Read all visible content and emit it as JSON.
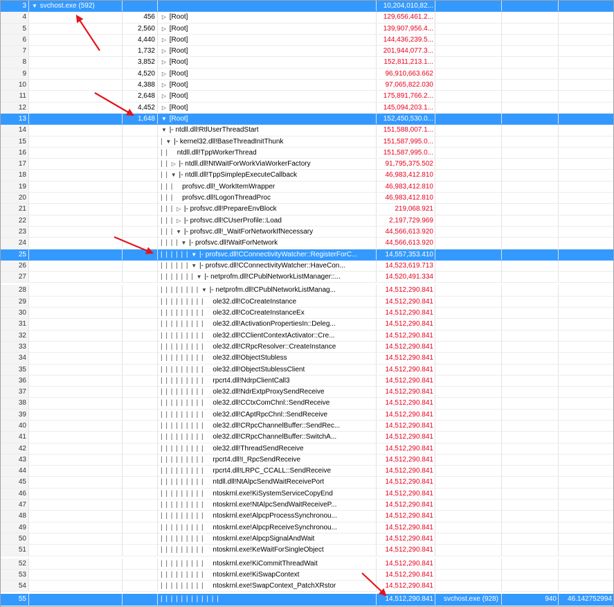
{
  "colors": {
    "selection": "#3399ff",
    "weight_text": "#e8001c",
    "arrow": "#e3141f"
  },
  "icons": {
    "expanded": "triangle-down-icon",
    "collapsed": "triangle-right-icon"
  },
  "rows": [
    {
      "line": "3",
      "process": "svchost.exe (592)",
      "thread": "",
      "stack": "svchost.exe (592)",
      "indent": 0,
      "guide": "",
      "toggle": "expanded",
      "weight": "10,204,010,82...",
      "sel": true,
      "gap": false
    },
    {
      "line": "4",
      "process": "",
      "thread": "456",
      "stack": "[Root]",
      "indent": 0,
      "guide": "",
      "toggle": "collapsed",
      "weight": "129,656,461.2..."
    },
    {
      "line": "5",
      "process": "",
      "thread": "2,560",
      "stack": "[Root]",
      "indent": 0,
      "guide": "",
      "toggle": "collapsed",
      "weight": "139,907,956.4..."
    },
    {
      "line": "6",
      "process": "",
      "thread": "4,440",
      "stack": "[Root]",
      "indent": 0,
      "guide": "",
      "toggle": "collapsed",
      "weight": "144,436,239.5..."
    },
    {
      "line": "7",
      "process": "",
      "thread": "1,732",
      "stack": "[Root]",
      "indent": 0,
      "guide": "",
      "toggle": "collapsed",
      "weight": "201,944,077.3..."
    },
    {
      "line": "8",
      "process": "",
      "thread": "3,852",
      "stack": "[Root]",
      "indent": 0,
      "guide": "",
      "toggle": "collapsed",
      "weight": "152,811,213.1..."
    },
    {
      "line": "9",
      "process": "",
      "thread": "4,520",
      "stack": "[Root]",
      "indent": 0,
      "guide": "",
      "toggle": "collapsed",
      "weight": "96,910,663.662"
    },
    {
      "line": "10",
      "process": "",
      "thread": "4,388",
      "stack": "[Root]",
      "indent": 0,
      "guide": "",
      "toggle": "collapsed",
      "weight": "97,065,822.030"
    },
    {
      "line": "11",
      "process": "",
      "thread": "2,648",
      "stack": "[Root]",
      "indent": 0,
      "guide": "",
      "toggle": "collapsed",
      "weight": "175,891,766.2..."
    },
    {
      "line": "12",
      "process": "",
      "thread": "4,452",
      "stack": "[Root]",
      "indent": 0,
      "guide": "",
      "toggle": "collapsed",
      "weight": "145,094,203.1..."
    },
    {
      "line": "13",
      "process": "",
      "thread": "1,648",
      "stack": "[Root]",
      "indent": 0,
      "guide": "",
      "toggle": "expanded",
      "weight": "152,450,530.0...",
      "sel": true
    },
    {
      "line": "14",
      "process": "",
      "thread": "",
      "stack": "|- ntdll.dll!RtlUserThreadStart",
      "indent": 0,
      "guide": "",
      "toggle": "expanded",
      "weight": "151,588,007.1..."
    },
    {
      "line": "15",
      "process": "",
      "thread": "",
      "stack": "|- kernel32.dll!BaseThreadInitThunk",
      "indent": 1,
      "guide": "|",
      "toggle": "expanded",
      "weight": "151,587,995.0..."
    },
    {
      "line": "16",
      "process": "",
      "thread": "",
      "stack": "ntdll.dll!TppWorkerThread",
      "indent": 1,
      "guide": "| |",
      "toggle": "",
      "weight": "151,587,995.0..."
    },
    {
      "line": "17",
      "process": "",
      "thread": "",
      "stack": "|- ntdll.dll!NtWaitForWorkViaWorkerFactory",
      "indent": 1,
      "guide": "| |",
      "toggle": "collapsed",
      "weight": "91,795,375.502"
    },
    {
      "line": "18",
      "process": "",
      "thread": "",
      "stack": "|- ntdll.dll!TppSimplepExecuteCallback",
      "indent": 1,
      "guide": "| |",
      "toggle": "expanded",
      "weight": "46,983,412.810"
    },
    {
      "line": "19",
      "process": "",
      "thread": "",
      "stack": "profsvc.dll!_WorkItemWrapper",
      "indent": 1,
      "guide": "| | |",
      "toggle": "",
      "weight": "46,983,412.810"
    },
    {
      "line": "20",
      "process": "",
      "thread": "",
      "stack": "profsvc.dll!LogonThreadProc",
      "indent": 1,
      "guide": "| | |",
      "toggle": "",
      "weight": "46,983,412.810"
    },
    {
      "line": "21",
      "process": "",
      "thread": "",
      "stack": "|- profsvc.dll!PrepareEnvBlock",
      "indent": 1,
      "guide": "| | |",
      "toggle": "collapsed",
      "weight": "219,068.921"
    },
    {
      "line": "22",
      "process": "",
      "thread": "",
      "stack": "|- profsvc.dll!CUserProfile::Load",
      "indent": 1,
      "guide": "| | |",
      "toggle": "collapsed",
      "weight": "2,197,729.969"
    },
    {
      "line": "23",
      "process": "",
      "thread": "",
      "stack": "|- profsvc.dll!_WaitForNetworkIfNecessary",
      "indent": 1,
      "guide": "| | |",
      "toggle": "expanded",
      "weight": "44,566,613.920"
    },
    {
      "line": "24",
      "process": "",
      "thread": "",
      "stack": "|- profsvc.dll!WaitForNetwork",
      "indent": 1,
      "guide": "| | | |",
      "toggle": "expanded",
      "weight": "44,566,613.920"
    },
    {
      "line": "25",
      "process": "",
      "thread": "",
      "stack": "|- profsvc.dll!CConnectivityWatcher::RegisterForC...",
      "indent": 1,
      "guide": "| | | | | |",
      "toggle": "expanded",
      "weight": "14,557,353.410",
      "sel": true
    },
    {
      "line": "26",
      "process": "",
      "thread": "",
      "stack": "|- profsvc.dll!CConnectivityWatcher::HaveCon...",
      "indent": 1,
      "guide": "| | | | | |",
      "toggle": "expanded",
      "weight": "14,523,619.713"
    },
    {
      "line": "27",
      "process": "",
      "thread": "",
      "stack": "|- netprofm.dll!CPublNetworkListManager::...",
      "indent": 1,
      "guide": "| | | | | | |",
      "toggle": "expanded",
      "weight": "14,520,491.334"
    },
    {
      "line": "28",
      "process": "",
      "thread": "",
      "stack": "|- netprofm.dll!CPublNetworkListManag...",
      "indent": 1,
      "guide": "| | | | | | | |",
      "toggle": "expanded",
      "weight": "14,512,290.841",
      "gap": true
    },
    {
      "line": "29",
      "process": "",
      "thread": "",
      "stack": "ole32.dll!CoCreateInstance",
      "indent": 1,
      "guide": "| | | | | | | | |",
      "toggle": "",
      "weight": "14,512,290.841"
    },
    {
      "line": "30",
      "process": "",
      "thread": "",
      "stack": "ole32.dll!CoCreateInstanceEx",
      "indent": 1,
      "guide": "| | | | | | | | |",
      "toggle": "",
      "weight": "14,512,290.841"
    },
    {
      "line": "31",
      "process": "",
      "thread": "",
      "stack": "ole32.dll!ActivationPropertiesIn::Deleg...",
      "indent": 1,
      "guide": "| | | | | | | | |",
      "toggle": "",
      "weight": "14,512,290.841"
    },
    {
      "line": "32",
      "process": "",
      "thread": "",
      "stack": "ole32.dll!CClientContextActivator::Cre...",
      "indent": 1,
      "guide": "| | | | | | | | |",
      "toggle": "",
      "weight": "14,512,290.841"
    },
    {
      "line": "33",
      "process": "",
      "thread": "",
      "stack": "ole32.dll!CRpcResolver::CreateInstance",
      "indent": 1,
      "guide": "| | | | | | | | |",
      "toggle": "",
      "weight": "14,512,290.841"
    },
    {
      "line": "34",
      "process": "",
      "thread": "",
      "stack": "ole32.dll!ObjectStubless",
      "indent": 1,
      "guide": "| | | | | | | | |",
      "toggle": "",
      "weight": "14,512,290.841"
    },
    {
      "line": "35",
      "process": "",
      "thread": "",
      "stack": "ole32.dll!ObjectStublessClient",
      "indent": 1,
      "guide": "| | | | | | | | |",
      "toggle": "",
      "weight": "14,512,290.841"
    },
    {
      "line": "36",
      "process": "",
      "thread": "",
      "stack": "rpcrt4.dll!NdrpClientCall3",
      "indent": 1,
      "guide": "| | | | | | | | |",
      "toggle": "",
      "weight": "14,512,290.841"
    },
    {
      "line": "37",
      "process": "",
      "thread": "",
      "stack": "ole32.dll!NdrExtpProxySendReceive",
      "indent": 1,
      "guide": "| | | | | | | | |",
      "toggle": "",
      "weight": "14,512,290.841"
    },
    {
      "line": "38",
      "process": "",
      "thread": "",
      "stack": "ole32.dll!CCtxComChnl::SendReceive",
      "indent": 1,
      "guide": "| | | | | | | | |",
      "toggle": "",
      "weight": "14,512,290.841"
    },
    {
      "line": "39",
      "process": "",
      "thread": "",
      "stack": "ole32.dll!CAptRpcChnl::SendReceive",
      "indent": 1,
      "guide": "| | | | | | | | |",
      "toggle": "",
      "weight": "14,512,290.841"
    },
    {
      "line": "40",
      "process": "",
      "thread": "",
      "stack": "ole32.dll!CRpcChannelBuffer::SendRec...",
      "indent": 1,
      "guide": "| | | | | | | | |",
      "toggle": "",
      "weight": "14,512,290.841"
    },
    {
      "line": "41",
      "process": "",
      "thread": "",
      "stack": "ole32.dll!CRpcChannelBuffer::SwitchA...",
      "indent": 1,
      "guide": "| | | | | | | | |",
      "toggle": "",
      "weight": "14,512,290.841"
    },
    {
      "line": "42",
      "process": "",
      "thread": "",
      "stack": "ole32.dll!ThreadSendReceive",
      "indent": 1,
      "guide": "| | | | | | | | |",
      "toggle": "",
      "weight": "14,512,290.841"
    },
    {
      "line": "43",
      "process": "",
      "thread": "",
      "stack": "rpcrt4.dll!I_RpcSendReceive",
      "indent": 1,
      "guide": "| | | | | | | | |",
      "toggle": "",
      "weight": "14,512,290.841"
    },
    {
      "line": "44",
      "process": "",
      "thread": "",
      "stack": "rpcrt4.dll!LRPC_CCALL::SendReceive",
      "indent": 1,
      "guide": "| | | | | | | | |",
      "toggle": "",
      "weight": "14,512,290.841"
    },
    {
      "line": "45",
      "process": "",
      "thread": "",
      "stack": "ntdll.dll!NtAlpcSendWaitReceivePort",
      "indent": 1,
      "guide": "| | | | | | | | |",
      "toggle": "",
      "weight": "14,512,290.841"
    },
    {
      "line": "46",
      "process": "",
      "thread": "",
      "stack": "ntoskrnl.exe!KiSystemServiceCopyEnd",
      "indent": 1,
      "guide": "| | | | | | | | |",
      "toggle": "",
      "weight": "14,512,290.841"
    },
    {
      "line": "47",
      "process": "",
      "thread": "",
      "stack": "ntoskrnl.exe!NtAlpcSendWaitReceiveP...",
      "indent": 1,
      "guide": "| | | | | | | | |",
      "toggle": "",
      "weight": "14,512,290.841"
    },
    {
      "line": "48",
      "process": "",
      "thread": "",
      "stack": "ntoskrnl.exe!AlpcpProcessSynchronou...",
      "indent": 1,
      "guide": "| | | | | | | | |",
      "toggle": "",
      "weight": "14,512,290.841"
    },
    {
      "line": "49",
      "process": "",
      "thread": "",
      "stack": "ntoskrnl.exe!AlpcpReceiveSynchronou...",
      "indent": 1,
      "guide": "| | | | | | | | |",
      "toggle": "",
      "weight": "14,512,290.841"
    },
    {
      "line": "50",
      "process": "",
      "thread": "",
      "stack": "ntoskrnl.exe!AlpcpSignalAndWait",
      "indent": 1,
      "guide": "| | | | | | | | |",
      "toggle": "",
      "weight": "14,512,290.841"
    },
    {
      "line": "51",
      "process": "",
      "thread": "",
      "stack": "ntoskrnl.exe!KeWaitForSingleObject",
      "indent": 1,
      "guide": "| | | | | | | | |",
      "toggle": "",
      "weight": "14,512,290.841"
    },
    {
      "line": "52",
      "process": "",
      "thread": "",
      "stack": "ntoskrnl.exe!KiCommitThreadWait",
      "indent": 1,
      "guide": "| | | | | | | | |",
      "toggle": "",
      "weight": "14,512,290.841",
      "gap": true
    },
    {
      "line": "53",
      "process": "",
      "thread": "",
      "stack": "ntoskrnl.exe!KiSwapContext",
      "indent": 1,
      "guide": "| | | | | | | | |",
      "toggle": "",
      "weight": "14,512,290.841"
    },
    {
      "line": "54",
      "process": "",
      "thread": "",
      "stack": "ntoskrnl.exe!SwapContext_PatchXRstor",
      "indent": 1,
      "guide": "| | | | | | | | |",
      "toggle": "",
      "weight": "14,512,290.841"
    },
    {
      "line": "55",
      "process": "",
      "thread": "",
      "stack": "",
      "indent": 1,
      "guide": "| | | | | | | | | | | |",
      "toggle": "",
      "weight": "14,512,290.841",
      "rproc": "svchost.exe (928)",
      "rthread": "940",
      "rweight": "46.142752994",
      "sel": true,
      "gap": true
    }
  ]
}
